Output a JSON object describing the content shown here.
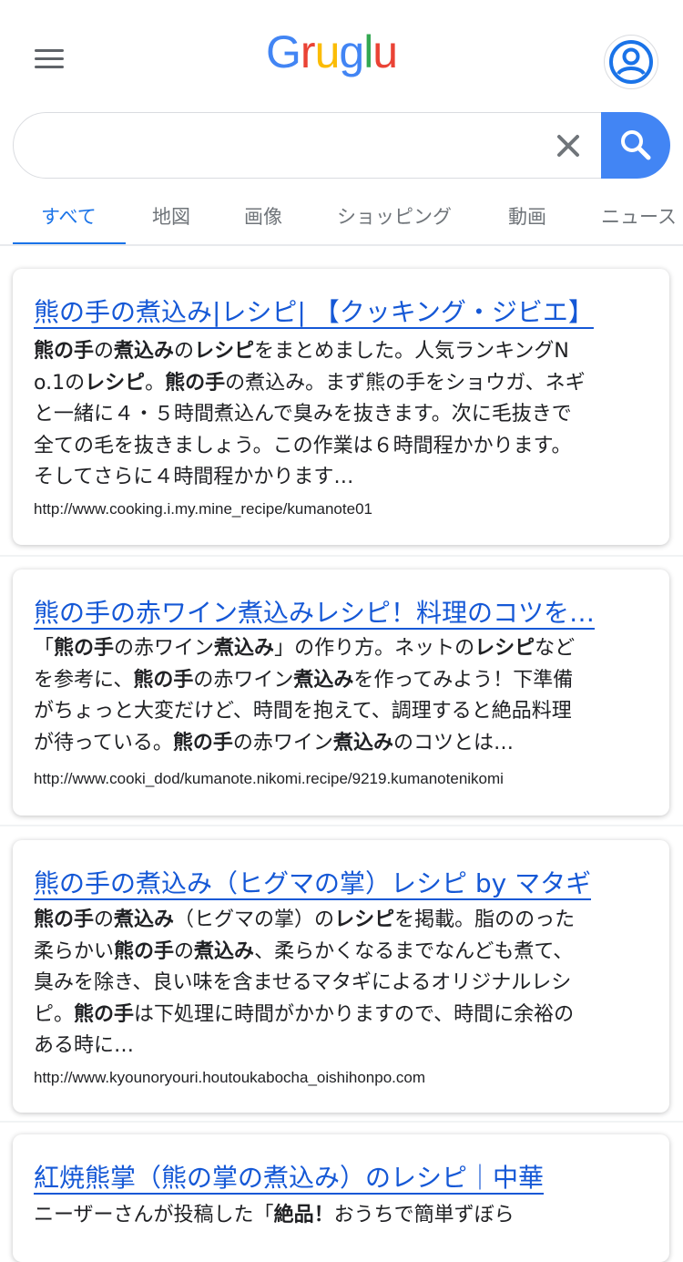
{
  "header": {
    "logo_letters": [
      {
        "char": "G",
        "color": "#4285f4"
      },
      {
        "char": "r",
        "color": "#ea4335"
      },
      {
        "char": "u",
        "color": "#fbbc05"
      },
      {
        "char": "g",
        "color": "#4285f4"
      },
      {
        "char": "l",
        "color": "#34a853"
      },
      {
        "char": "u",
        "color": "#ea4335"
      }
    ],
    "menu_icon": "hamburger-menu-icon",
    "avatar_icon": "account-circle-icon"
  },
  "search": {
    "value": "",
    "placeholder": "",
    "clear_icon": "close-icon",
    "search_icon": "magnifier-icon",
    "button_color": "#4285f4"
  },
  "tabs": [
    {
      "label": "すべて",
      "active": true
    },
    {
      "label": "地図",
      "active": false
    },
    {
      "label": "画像",
      "active": false
    },
    {
      "label": "ショッピング",
      "active": false
    },
    {
      "label": "動画",
      "active": false
    },
    {
      "label": "ニュース",
      "active": false
    }
  ],
  "colors": {
    "link": "#1558d6",
    "accent": "#1a73e8",
    "text": "#202124"
  },
  "results": [
    {
      "title": "熊の手の煮込み|レシピ| 【クッキング・ジビエ】",
      "snippet": [
        [
          {
            "t": "熊の手",
            "b": true
          },
          {
            "t": "の",
            "b": false
          },
          {
            "t": "煮込み",
            "b": true
          },
          {
            "t": "の",
            "b": false
          },
          {
            "t": "レシピ",
            "b": true
          },
          {
            "t": "をまとめました。人気ランキングN",
            "b": false
          }
        ],
        [
          {
            "t": "o.1の",
            "b": false
          },
          {
            "t": "レシピ",
            "b": true
          },
          {
            "t": "。",
            "b": false
          },
          {
            "t": "熊の手",
            "b": true
          },
          {
            "t": "の煮込み。まず熊の手をショウガ、ネギ",
            "b": false
          }
        ],
        [
          {
            "t": "と一緒に４・５時間煮込んで臭みを抜きます。次に毛抜きで",
            "b": false
          }
        ],
        [
          {
            "t": "全ての毛を抜きましょう。この作業は６時間程かかります。",
            "b": false
          }
        ],
        [
          {
            "t": "そしてさらに４時間程かかります…",
            "b": false
          }
        ]
      ],
      "url": "http://www.cooking.i.my.mine_recipe/kumanote01"
    },
    {
      "title": "熊の手の赤ワイン煮込みレシピ！料理のコツを…",
      "snippet": [
        [
          {
            "t": "「",
            "b": false
          },
          {
            "t": "熊の手",
            "b": true
          },
          {
            "t": "の赤ワイン",
            "b": false
          },
          {
            "t": "煮込み",
            "b": true
          },
          {
            "t": "」の作り方。ネットの",
            "b": false
          },
          {
            "t": "レシピ",
            "b": true
          },
          {
            "t": "など",
            "b": false
          }
        ],
        [
          {
            "t": "を参考に、",
            "b": false
          },
          {
            "t": "熊の手",
            "b": true
          },
          {
            "t": "の赤ワイン",
            "b": false
          },
          {
            "t": "煮込み",
            "b": true
          },
          {
            "t": "を作ってみよう！下準備",
            "b": false
          }
        ],
        [
          {
            "t": "がちょっと大変だけど、時間を抱えて、調理すると絶品料理",
            "b": false
          }
        ],
        [
          {
            "t": "が待っている。",
            "b": false
          },
          {
            "t": "熊の手",
            "b": true
          },
          {
            "t": "の赤ワイン",
            "b": false
          },
          {
            "t": "煮込み",
            "b": true
          },
          {
            "t": "のコツとは…",
            "b": false
          }
        ]
      ],
      "url": "http://www.cooki_dod/kumanote.nikomi.recipe/9219.kumanotenikomi"
    },
    {
      "title": "熊の手の煮込み（ヒグマの掌）レシピ by マタギ",
      "snippet": [
        [
          {
            "t": "熊の手",
            "b": true
          },
          {
            "t": "の",
            "b": false
          },
          {
            "t": "煮込み",
            "b": true
          },
          {
            "t": "（ヒグマの掌）の",
            "b": false
          },
          {
            "t": "レシピ",
            "b": true
          },
          {
            "t": "を掲載。脂ののった",
            "b": false
          }
        ],
        [
          {
            "t": "柔らかい",
            "b": false
          },
          {
            "t": "熊の手",
            "b": true
          },
          {
            "t": "の",
            "b": false
          },
          {
            "t": "煮込み",
            "b": true
          },
          {
            "t": "、柔らかくなるまでなんども煮て、",
            "b": false
          }
        ],
        [
          {
            "t": "臭みを除き、良い味を含ませるマタギによるオリジナルレシ",
            "b": false
          }
        ],
        [
          {
            "t": "ピ。",
            "b": false
          },
          {
            "t": "熊の手",
            "b": true
          },
          {
            "t": "は下処理に時間がかかりますので、時間に余裕の",
            "b": false
          }
        ],
        [
          {
            "t": "ある時に…",
            "b": false
          }
        ]
      ],
      "url": "http://www.kyounoryouri.houtoukabocha_oishihonpo.com"
    },
    {
      "title": "紅焼熊掌（熊の掌の煮込み）のレシピ｜中華",
      "snippet": [
        [
          {
            "t": "ニーザーさんが投稿した「",
            "b": false
          },
          {
            "t": "絶品！",
            "b": true
          },
          {
            "t": "おうちで簡単ずぼら",
            "b": false
          }
        ]
      ],
      "url": ""
    }
  ]
}
